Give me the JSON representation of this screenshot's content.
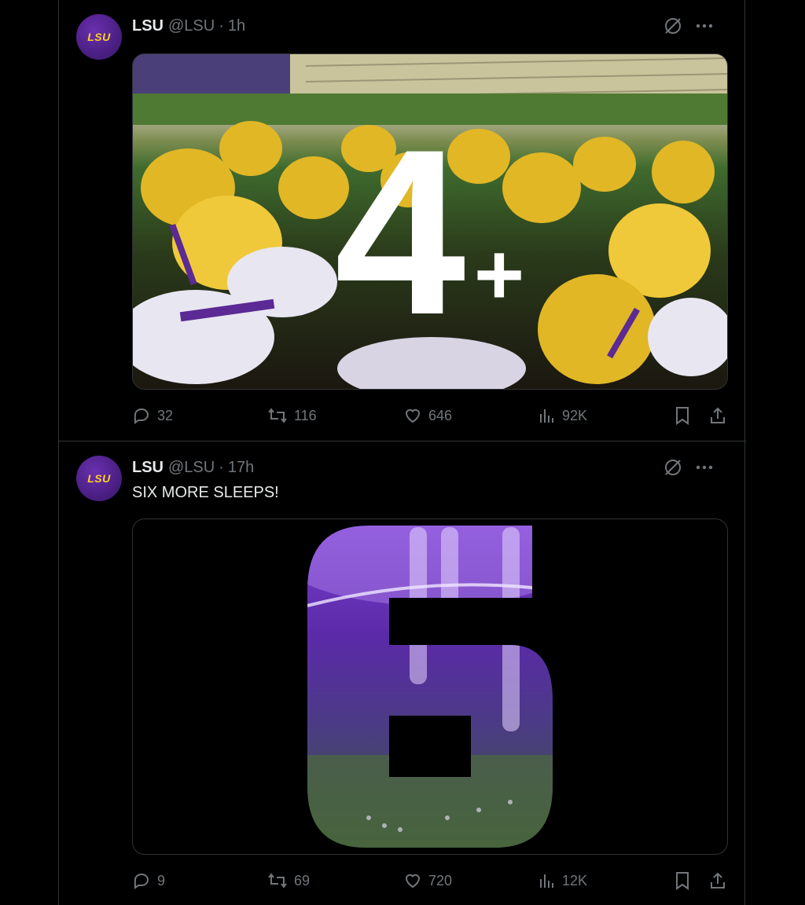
{
  "tweets": [
    {
      "display_name": "LSU",
      "handle": "@LSU",
      "separator": "·",
      "time": "1h",
      "avatar_text": "LSU",
      "text": "",
      "media": {
        "overlay_number": "4",
        "overlay_suffix": "+",
        "description_icon": "football-huddle-photo"
      },
      "stats": {
        "replies": "32",
        "reposts": "116",
        "likes": "646",
        "views": "92K"
      }
    },
    {
      "display_name": "LSU",
      "handle": "@LSU",
      "separator": "·",
      "time": "17h",
      "avatar_text": "LSU",
      "text": "SIX MORE SLEEPS!",
      "media": {
        "description_icon": "number-six-stadium-graphic"
      },
      "stats": {
        "replies": "9",
        "reposts": "69",
        "likes": "720",
        "views": "12K"
      }
    }
  ],
  "colors": {
    "lsu_purple": "#461D7C",
    "lsu_gold": "#FDD023",
    "muted": "#71767b",
    "text": "#e7e9ea",
    "border": "#2f3336"
  }
}
